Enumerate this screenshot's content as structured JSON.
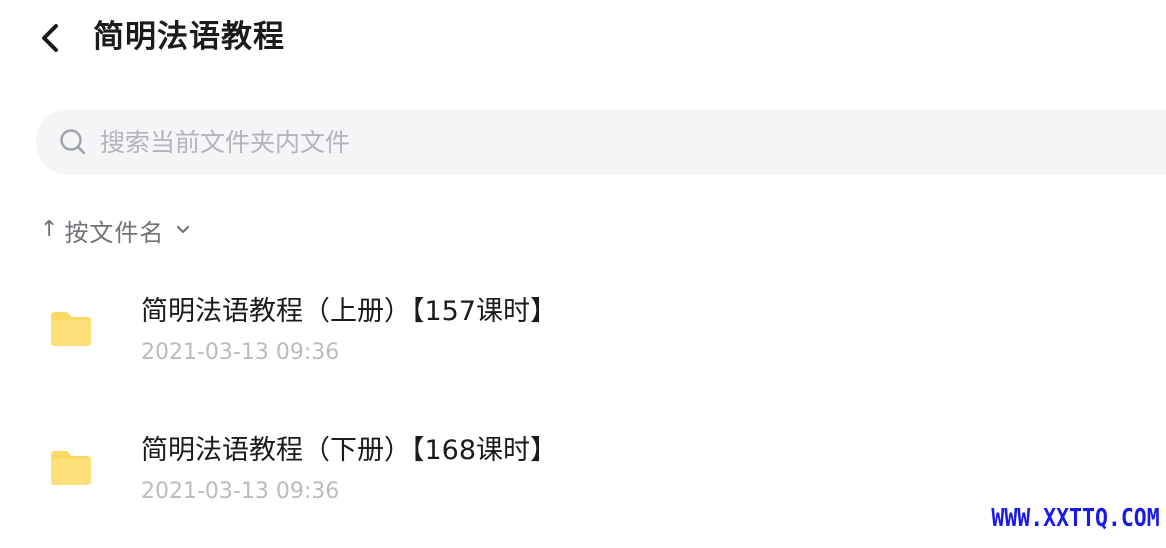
{
  "header": {
    "title": "简明法语教程",
    "back_icon": "chevron-left-icon"
  },
  "search": {
    "placeholder": "搜索当前文件夹内文件",
    "value": "",
    "icon": "search-icon"
  },
  "sort": {
    "label": "按文件名",
    "direction": "ascending",
    "arrow_icon": "arrow-up-icon",
    "dropdown_icon": "chevron-down-icon"
  },
  "files": [
    {
      "name": "简明法语教程（上册）【157课时】",
      "date": "2021-03-13 09:36",
      "type": "folder",
      "icon": "folder-icon"
    },
    {
      "name": "简明法语教程（下册）【168课时】",
      "date": "2021-03-13 09:36",
      "type": "folder",
      "icon": "folder-icon"
    }
  ],
  "watermark": {
    "text": "WWW.XXTTQ.COM"
  },
  "colors": {
    "folder": "#fcd962",
    "search_bg": "#f4f5f7",
    "muted_text": "#b9bbbf",
    "watermark": "#1a1ae6"
  }
}
